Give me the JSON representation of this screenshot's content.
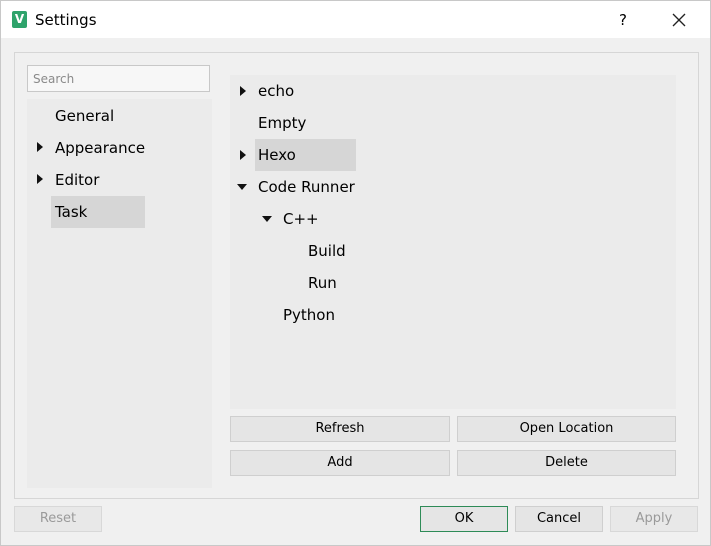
{
  "window": {
    "title": "Settings",
    "help_label": "?"
  },
  "search": {
    "placeholder": "Search"
  },
  "sidebar": {
    "items": [
      {
        "label": "General",
        "expandable": false,
        "selected": false
      },
      {
        "label": "Appearance",
        "expandable": true,
        "selected": false
      },
      {
        "label": "Editor",
        "expandable": true,
        "selected": false
      },
      {
        "label": "Task",
        "expandable": false,
        "selected": true
      }
    ]
  },
  "tasks": {
    "tree": [
      {
        "label": "echo",
        "level": 0,
        "state": "collapsed"
      },
      {
        "label": "Empty",
        "level": 0,
        "state": "leaf"
      },
      {
        "label": "Hexo",
        "level": 0,
        "state": "collapsed",
        "selected": true
      },
      {
        "label": "Code Runner",
        "level": 0,
        "state": "expanded"
      },
      {
        "label": "C++",
        "level": 1,
        "state": "expanded"
      },
      {
        "label": "Build",
        "level": 2,
        "state": "leaf"
      },
      {
        "label": "Run",
        "level": 2,
        "state": "leaf"
      },
      {
        "label": "Python",
        "level": 1,
        "state": "leaf"
      }
    ],
    "buttons": {
      "refresh": "Refresh",
      "open_location": "Open Location",
      "add": "Add",
      "delete": "Delete"
    }
  },
  "footer": {
    "reset": "Reset",
    "ok": "OK",
    "cancel": "Cancel",
    "apply": "Apply"
  },
  "colors": {
    "accent": "#2ea36b",
    "selection": "#d6d6d6",
    "panel": "#ebebeb"
  }
}
